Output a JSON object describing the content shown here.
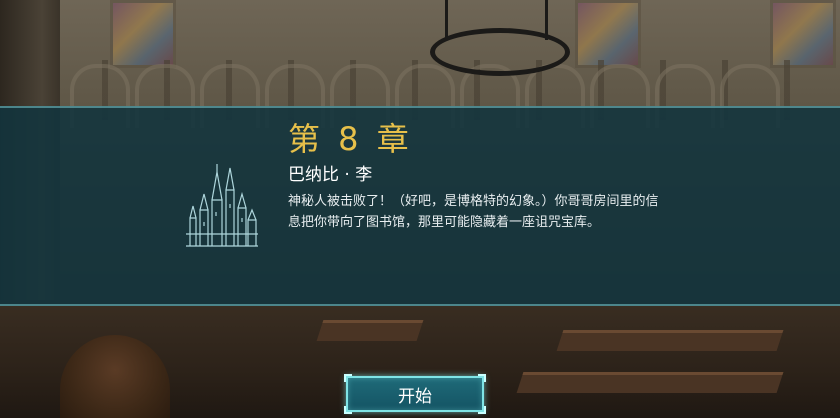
{
  "chapter": {
    "title": "第 8 章",
    "subtitle": "巴纳比 · 李",
    "description": "神秘人被击败了！（好吧，是博格特的幻象。）你哥哥房间里的信息把你带向了图书馆，那里可能隐藏着一座诅咒宝库。",
    "emblem_icon": "castle-icon"
  },
  "actions": {
    "start_label": "开始"
  },
  "colors": {
    "title": "#e7c04a",
    "band": "#12343e",
    "button_border": "#7fe4e6"
  }
}
